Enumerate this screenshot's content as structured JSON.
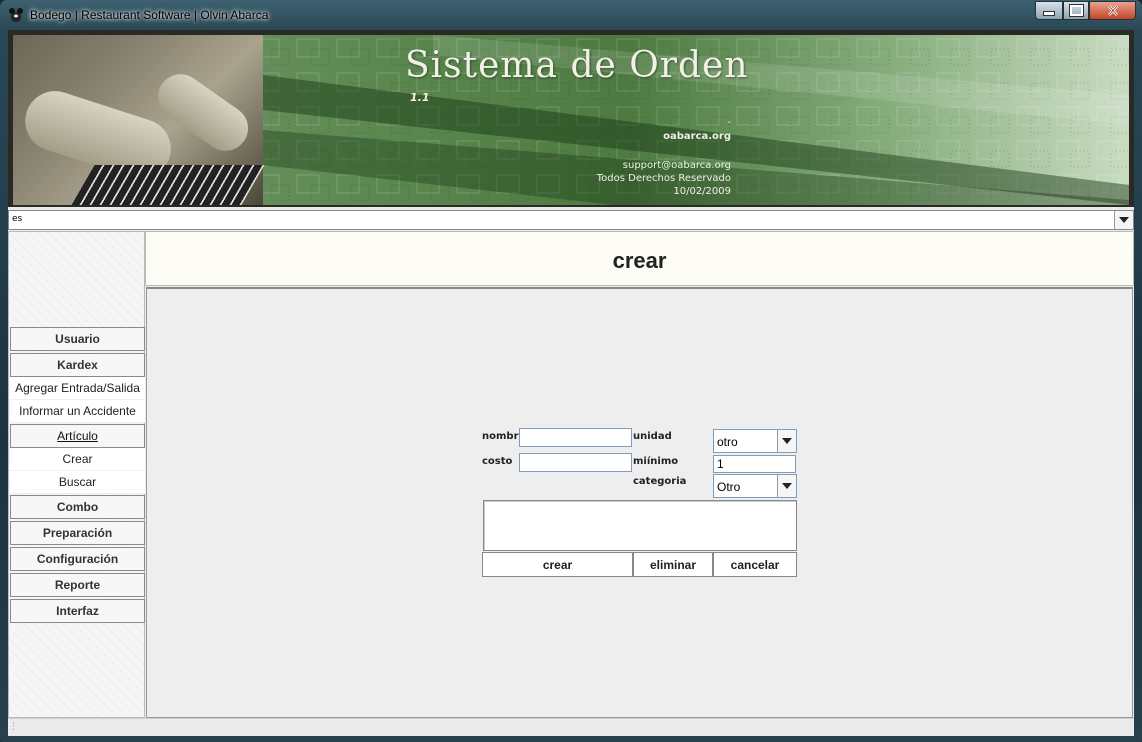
{
  "window": {
    "title": "Bodego | Restaurant Software | Olvin Abarca"
  },
  "banner": {
    "title": "Sistema de Orden",
    "version": "1.1",
    "dash": "-",
    "website": "oabarca.org",
    "email": "support@oabarca.org",
    "rights": "Todos Derechos Reservado",
    "date": "10/02/2009"
  },
  "language": {
    "selected": "es"
  },
  "sidebar": {
    "sections": [
      {
        "label": "Usuario",
        "items": []
      },
      {
        "label": "Kardex",
        "items": [
          "Agregar Entrada/Salida",
          "Informar un Accidente"
        ]
      },
      {
        "label": "Artículo",
        "items": [
          "Crear",
          "Buscar"
        ]
      },
      {
        "label": "Combo",
        "items": []
      },
      {
        "label": "Preparación",
        "items": []
      },
      {
        "label": "Configuración",
        "items": []
      },
      {
        "label": "Reporte",
        "items": []
      },
      {
        "label": "Interfaz",
        "items": []
      }
    ]
  },
  "content": {
    "title": "crear"
  },
  "form": {
    "nombre_label": "nombre",
    "nombre_value": "",
    "costo_label": "costo",
    "costo_value": "",
    "unidad_label": "unidad",
    "unidad_value": "otro",
    "minimo_label": "miínimo",
    "minimo_value": "1",
    "categoria_label": "categoria",
    "categoria_value": "Otro",
    "description_value": "",
    "crear_button": "crear",
    "eliminar_button": "eliminar",
    "cancelar_button": "cancelar"
  },
  "colors": {
    "banner_green": "#4c7a40",
    "panel_bg": "#eeeeee",
    "header_bg": "#fdfdf6"
  }
}
